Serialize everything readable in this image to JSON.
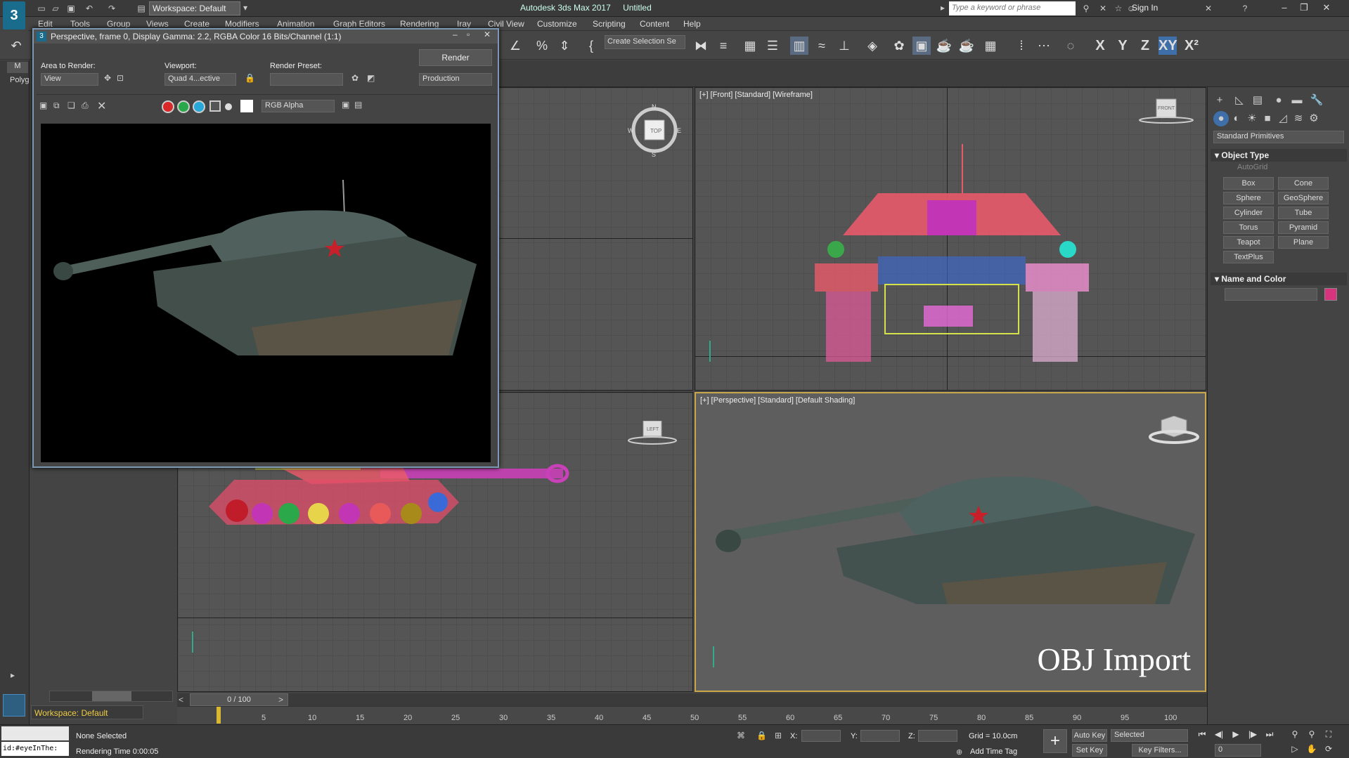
{
  "app": {
    "title": "Autodesk 3ds Max 2017",
    "document": "Untitled",
    "workspace": "Workspace: Default",
    "search_placeholder": "Type a keyword or phrase",
    "sign_in": "Sign In"
  },
  "menus": [
    "Edit",
    "Tools",
    "Group",
    "Views",
    "Create",
    "Modifiers",
    "Animation",
    "Graph Editors",
    "Rendering",
    "Iray",
    "Civil View",
    "Customize",
    "Scripting",
    "Content",
    "Help"
  ],
  "toolbar": {
    "create_selection": "Create Selection Se",
    "axes": [
      "X",
      "Y",
      "Z",
      "XY",
      "X²"
    ]
  },
  "render_window": {
    "title": "Perspective, frame 0, Display Gamma: 2.2, RGBA Color 16 Bits/Channel (1:1)",
    "area_label": "Area to Render:",
    "area_value": "View",
    "viewport_label": "Viewport:",
    "viewport_value": "Quad 4...ective",
    "preset_label": "Render Preset:",
    "preset_value": "",
    "render_button": "Render",
    "production": "Production",
    "channel": "RGB Alpha"
  },
  "viewports": {
    "front": {
      "labels": [
        "[+]",
        "[Front]",
        "[Standard]",
        "[Wireframe]"
      ],
      "cube": "FRONT"
    },
    "perspective": {
      "labels": [
        "[+]",
        "[Perspective]",
        "[Standard]",
        "[Default Shading]"
      ],
      "overlay": "OBJ Import"
    },
    "top": {
      "compass": [
        "N",
        "W",
        "E",
        "S"
      ],
      "cube": "TOP"
    },
    "left": {
      "cube": "LEFT"
    }
  },
  "command_panel": {
    "category": "Standard Primitives",
    "object_type": "Object Type",
    "autogrid": "AutoGrid",
    "primitives": [
      "Box",
      "Cone",
      "Sphere",
      "GeoSphere",
      "Cylinder",
      "Tube",
      "Torus",
      "Pyramid",
      "Teapot",
      "Plane",
      "TextPlus"
    ],
    "name_and_color": "Name and Color",
    "object_color": "#d8347e"
  },
  "timeline": {
    "slider": "0 / 100",
    "ticks": [
      "5",
      "10",
      "15",
      "20",
      "25",
      "30",
      "35",
      "40",
      "45",
      "50",
      "55",
      "60",
      "65",
      "70",
      "75",
      "80",
      "85",
      "90",
      "95",
      "100"
    ]
  },
  "status": {
    "selection": "None Selected",
    "render_time": "Rendering Time  0:00:05",
    "maxscript": "id:#eyeInThe:",
    "x_label": "X:",
    "y_label": "Y:",
    "z_label": "Z:",
    "grid": "Grid = 10.0cm",
    "add_time_tag": "Add Time Tag",
    "auto_key": "Auto Key",
    "set_key": "Set Key",
    "selected": "Selected",
    "key_filters": "Key Filters...",
    "frame": "0"
  },
  "workspace_bottom": "Workspace: Default",
  "left_panel": {
    "tab1": "M",
    "tab2": "Polyg"
  }
}
